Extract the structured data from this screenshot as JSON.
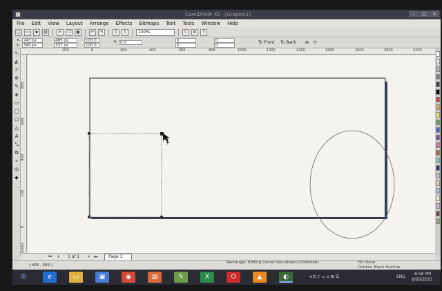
{
  "window": {
    "title": "CorelDRAW X5 - [Graphic1]",
    "controls": [
      "–",
      "□",
      "✕"
    ]
  },
  "menu": [
    "File",
    "Edit",
    "View",
    "Layout",
    "Arrange",
    "Effects",
    "Bitmaps",
    "Text",
    "Tools",
    "Window",
    "Help"
  ],
  "toolbar": {
    "zoom_value": "100%"
  },
  "propbar": {
    "x": "243 px",
    "y": "349 px",
    "width": "485 px",
    "height": "337 px",
    "scale_x": "100.0",
    "scale_y": "100.0",
    "rotation": "0.0",
    "corner_tl": "0",
    "corner_bl": "0",
    "corner_tr": "0",
    "corner_br": "0",
    "to_front": "To Front",
    "to_back": "To Back"
  },
  "ruler_h": [
    "200",
    "0",
    "200",
    "400",
    "600",
    "800",
    "1000",
    "1200",
    "1400",
    "1600",
    "1800",
    "2000",
    "2200"
  ],
  "ruler_v": [
    "800",
    "600",
    "400",
    "200",
    "0"
  ],
  "ruler_units": "pixels",
  "navbar": {
    "page_count": "1 of 1",
    "page_tab": "Page 1"
  },
  "status": {
    "coords": "( 406 , 689 )",
    "message": "Rectangle: Editing Corner Roundness (Distorted)",
    "fill": "Fill: None",
    "outline": "Outline: Black  Hairline"
  },
  "tray": {
    "lang": "ENG",
    "time": "8:58 PM",
    "date": "9/26/2021"
  },
  "palette": [
    "#ffffff",
    "#e6e6e6",
    "#b3b3b3",
    "#808080",
    "#404040",
    "#000000",
    "#d63a3a",
    "#e8a84a",
    "#f0e060",
    "#5aa85a",
    "#3a6ad0",
    "#8a4ab0",
    "#f06aa0",
    "#a86a3a",
    "#6ad0d0",
    "#2a3a8a",
    "#c0c0c0",
    "#e0d0b0",
    "#a0c0e0",
    "#f0f0d0",
    "#d0b0d0",
    "#705040",
    "#90b070"
  ],
  "icons": [
    "app-icon",
    "new-icon",
    "open-icon",
    "save-icon",
    "print-icon",
    "cut-icon",
    "copy-icon",
    "paste-icon",
    "undo-icon",
    "redo-icon",
    "import-icon",
    "export-icon",
    "zoom-icon",
    "pick-tool-icon",
    "shape-tool-icon",
    "zoom-tool-icon",
    "freehand-tool-icon",
    "rectangle-tool-icon",
    "ellipse-tool-icon",
    "text-tool-icon",
    "fill-tool-icon",
    "windows-start-icon",
    "ie-icon",
    "explorer-icon",
    "chrome-icon",
    "opera-icon",
    "vlc-icon",
    "coreldraw-icon"
  ]
}
